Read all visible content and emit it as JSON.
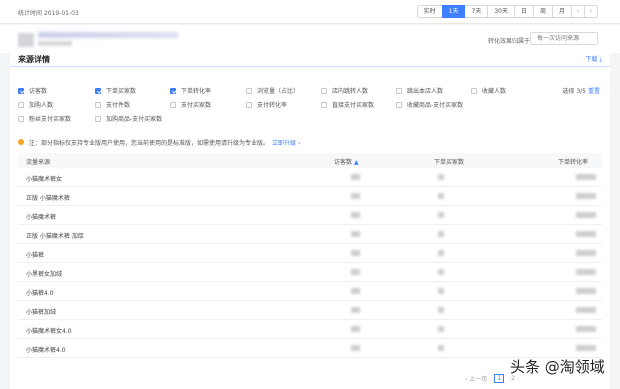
{
  "header": {
    "stat_time_label": "统计时间 2019-01-03",
    "ranges": [
      {
        "label": "实时",
        "active": false
      },
      {
        "label": "1天",
        "active": true
      },
      {
        "label": "7天",
        "active": false
      },
      {
        "label": "30天",
        "active": false
      },
      {
        "label": "日",
        "active": false
      },
      {
        "label": "周",
        "active": false
      },
      {
        "label": "月",
        "active": false
      }
    ],
    "prev_icon": "chevron-left-icon",
    "next_icon": "chevron-right-icon"
  },
  "shop": {
    "attribution_label": "转化效果归属于：",
    "attribution_value": "每一次访问来源"
  },
  "panel": {
    "title": "来源详情",
    "download_label": "下载",
    "download_icon": "download-icon"
  },
  "metrics": [
    {
      "label": "访客数",
      "checked": true
    },
    {
      "label": "下单买家数",
      "checked": true
    },
    {
      "label": "下单转化率",
      "checked": true
    },
    {
      "label": "浏览量（占比）",
      "checked": false
    },
    {
      "label": "店内跳转人数",
      "checked": false
    },
    {
      "label": "跳出本店人数",
      "checked": false
    },
    {
      "label": "收藏人数",
      "checked": false
    },
    {
      "label": "加购人数",
      "checked": false
    },
    {
      "label": "支付件数",
      "checked": false
    },
    {
      "label": "支付买家数",
      "checked": false
    },
    {
      "label": "支付转化率",
      "checked": false
    },
    {
      "label": "直接支付买家数",
      "checked": false
    },
    {
      "label": "收藏商品-支付买家数",
      "checked": false
    },
    {
      "label": "粉丝支付买家数",
      "checked": false
    },
    {
      "label": "加购商品-支付买家数",
      "checked": false
    }
  ],
  "selection": {
    "count_label": "选择 3/5",
    "reset_label": "重置"
  },
  "tip": {
    "text": "注：部分指标仅支持专业版用户使用，您当前使用的是标准版，如需使用请升级为专业版。",
    "link": "立即升级",
    "link_arrow": "›"
  },
  "table": {
    "headers": [
      "流量来源",
      "访客数",
      "下单买家数",
      "下单转化率"
    ],
    "sort_icon": "▲",
    "rows": [
      "小猫魔术裤女",
      "正版 小猫魔术裤",
      "小猫魔术裤",
      "正版 小猫魔术裤 加厚",
      "小猫裤",
      "小黑裤女加绒",
      "小猫裤4.0",
      "小猫裤加绒",
      "小猫魔术裤女4.0",
      "小猫魔术裤4.0"
    ]
  },
  "pager": {
    "prev_label": "‹ 上一页",
    "pages": [
      "1",
      "2"
    ],
    "current": "1"
  },
  "watermark": "头条 @淘领域"
}
